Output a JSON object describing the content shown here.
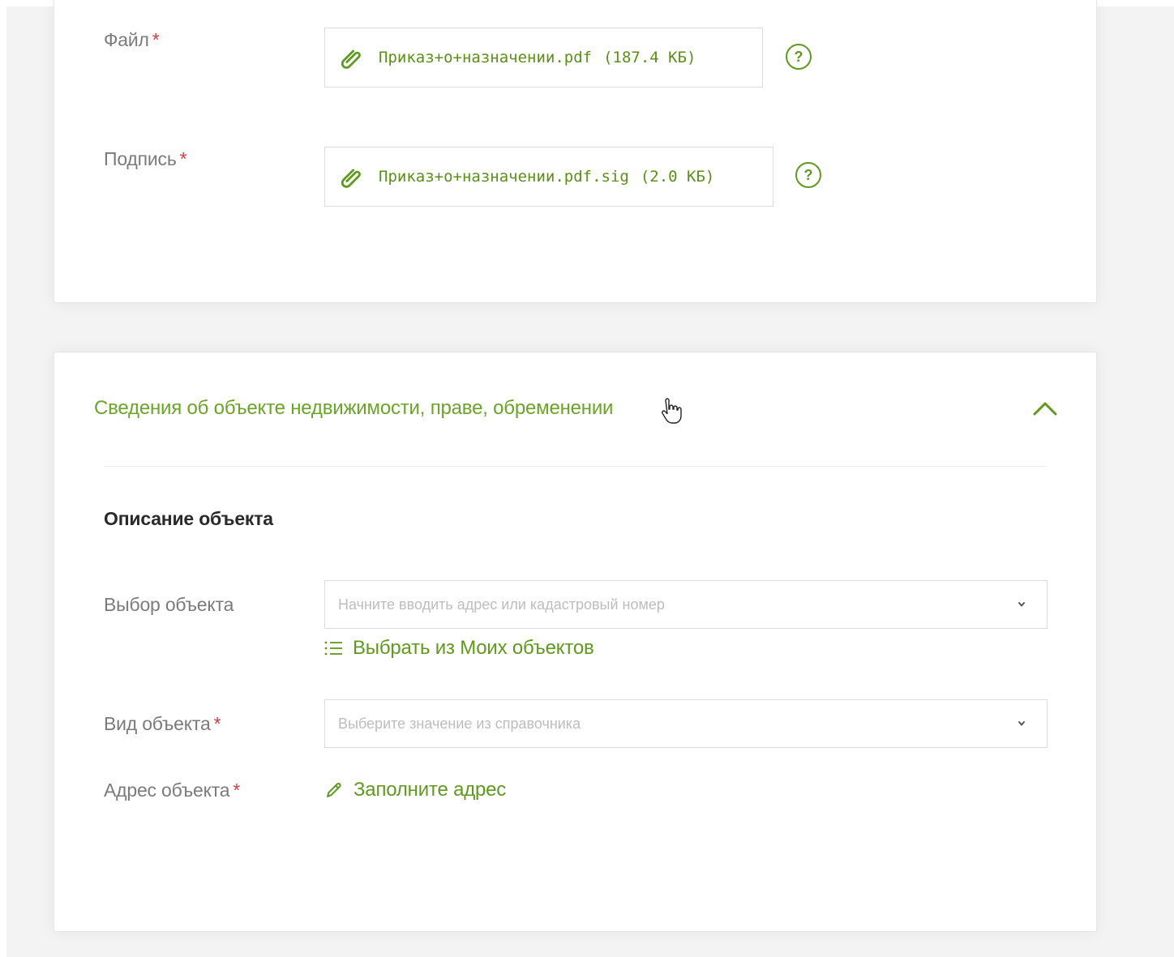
{
  "attachments": {
    "file": {
      "label": "Файл",
      "required_mark": "*",
      "filename": "Приказ+о+назначении.pdf",
      "size": "(187.4 КБ)"
    },
    "signature": {
      "label": "Подпись",
      "required_mark": "*",
      "filename": "Приказ+о+назначении.pdf.sig",
      "size": "(2.0 КБ)"
    },
    "help_glyph": "?"
  },
  "section": {
    "title": "Сведения об объекте недвижимости, праве, обременении",
    "expanded": true,
    "subheading": "Описание объекта",
    "fields": {
      "object_select": {
        "label": "Выбор объекта",
        "placeholder": "Начните вводить адрес или кадастровый номер",
        "my_objects_link": "Выбрать из Моих объектов"
      },
      "object_type": {
        "label": "Вид объекта",
        "required_mark": "*",
        "placeholder": "Выберите значение из справочника"
      },
      "object_address": {
        "label": "Адрес объекта",
        "required_mark": "*",
        "fill_link": "Заполните адрес"
      }
    }
  },
  "colors": {
    "accent_green": "#5f9a1e",
    "required_red": "#d23b3b",
    "label_gray": "#7b7b7b"
  },
  "icons": [
    "paperclip-icon",
    "help-icon",
    "chevron-up-icon",
    "hand-cursor-icon",
    "list-icon",
    "chevron-down-icon",
    "pencil-icon"
  ]
}
